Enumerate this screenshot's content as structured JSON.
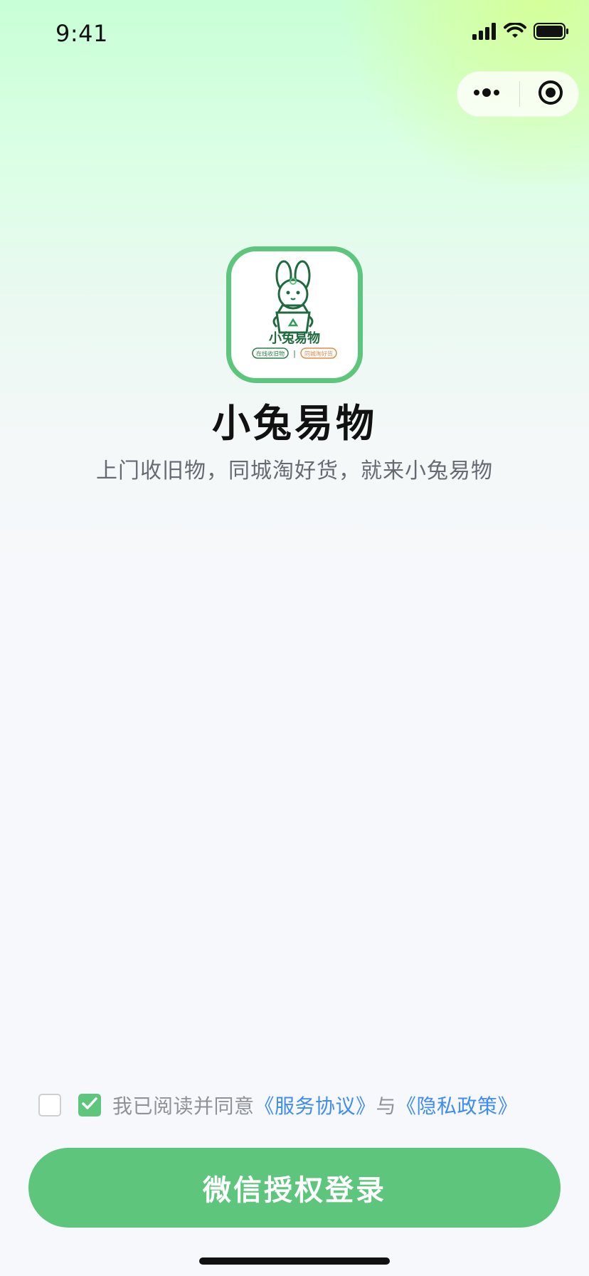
{
  "status_bar": {
    "time": "9:41"
  },
  "mini_program_capsule": {
    "more_icon": "more-dots-icon",
    "close_icon": "target-icon"
  },
  "app": {
    "title": "小兔易物",
    "subtitle": "上门收旧物，同城淘好货，就来小兔易物",
    "logo": {
      "text": "小兔易物",
      "tag_left": "在线收旧物",
      "tag_right": "同城淘好货",
      "separator": "|"
    }
  },
  "agreement": {
    "text_prefix": "我已阅读并同意",
    "service_link": "《服务协议》",
    "connector": "与",
    "privacy_link": "《隐私政策》",
    "checkbox_left_checked": false,
    "checkbox_right_checked": true
  },
  "actions": {
    "login_button": "微信授权登录"
  },
  "colors": {
    "primary": "#5ec57d",
    "link": "#3f8cf3",
    "text_secondary": "#666a72"
  }
}
